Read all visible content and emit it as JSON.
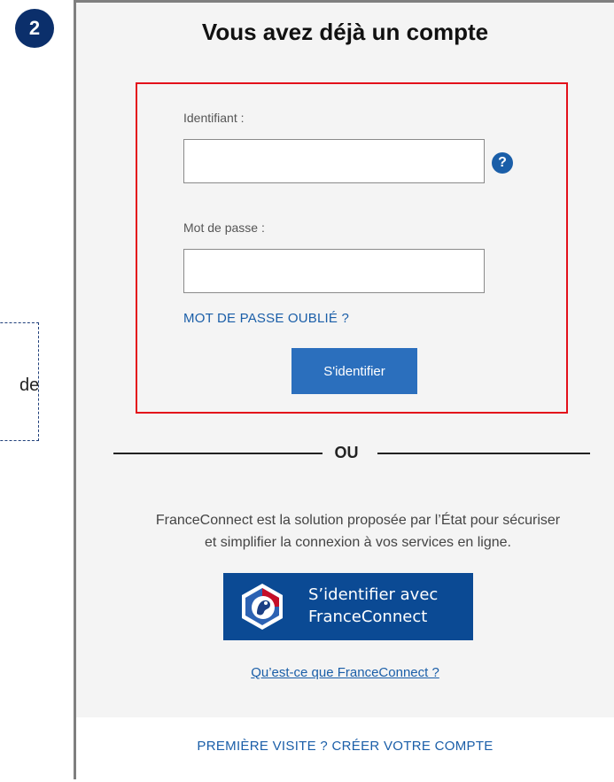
{
  "step_badge": "2",
  "side_note_text": "de",
  "title": "Vous avez déjà un compte",
  "login": {
    "username_label": "Identifiant :",
    "username_value": "",
    "help_icon": "?",
    "password_label": "Mot de passe :",
    "password_value": "",
    "forgot_password": "MOT DE PASSE OUBLIÉ ?",
    "submit_label": "S'identifier"
  },
  "divider": "OU",
  "franceconnect": {
    "description_line1": "FranceConnect est la solution proposée par l’État pour sécuriser",
    "description_line2": "et simplifier la connexion à vos services en ligne.",
    "button_line1": "S’identifier avec",
    "button_line2": "FranceConnect",
    "info_link": "Qu’est-ce que FranceConnect ?"
  },
  "register_link": "PREMIÈRE VISITE ? CRÉER VOTRE COMPTE",
  "colors": {
    "accent": "#2b6fbd",
    "franceconnect_blue": "#0b4a94",
    "highlight_border": "#e3101a",
    "badge": "#0b2f6b",
    "panel_bg": "#f4f4f4"
  },
  "icons": {
    "help": "question-circle-icon",
    "franceconnect": "franceconnect-logo-icon"
  }
}
